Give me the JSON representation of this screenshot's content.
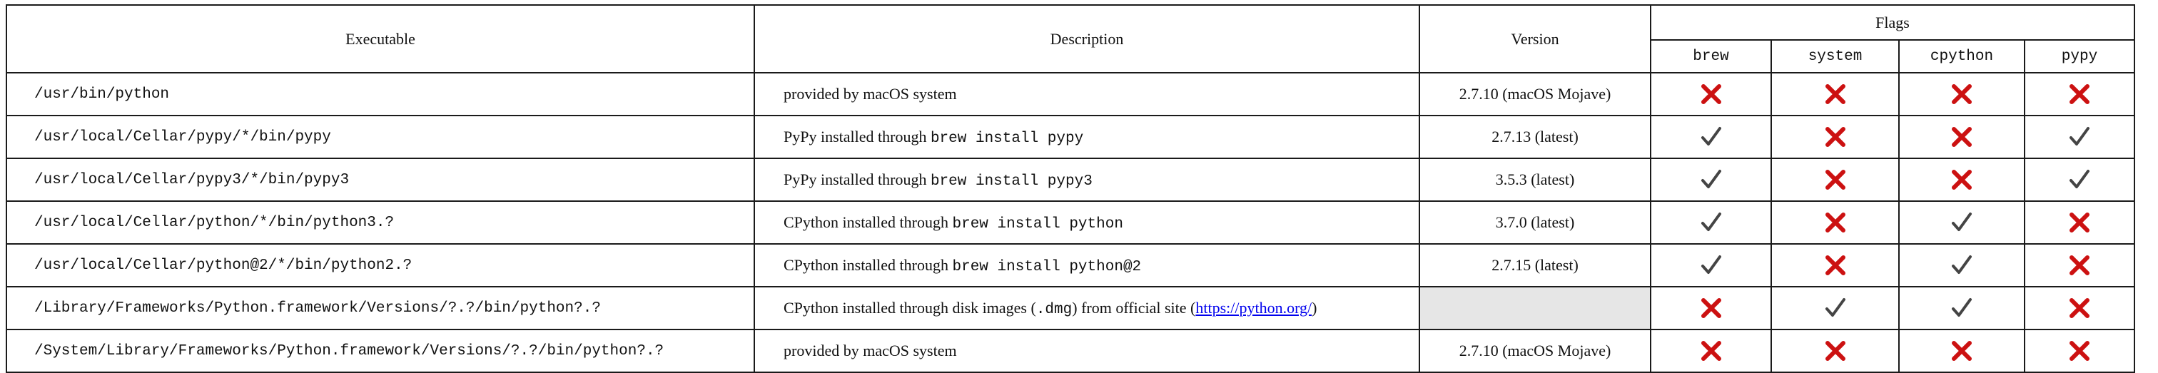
{
  "headers": {
    "executable": "Executable",
    "description": "Description",
    "version": "Version",
    "flags": "Flags",
    "flag_names": [
      "brew",
      "system",
      "cpython",
      "pypy"
    ]
  },
  "colors": {
    "cross": "#cc1111",
    "check": "#444444",
    "empty_cell": "#e6e6e6"
  },
  "icons": {
    "yes": "check-icon",
    "no": "cross-icon"
  },
  "rows": [
    {
      "executable": "/usr/bin/python",
      "desc_text": "provided by macOS system",
      "desc_code": "",
      "desc_suffix": "",
      "version": "2.7.10 (macOS Mojave)",
      "flags": [
        false,
        false,
        false,
        false
      ]
    },
    {
      "executable": "/usr/local/Cellar/pypy/*/bin/pypy",
      "desc_text": "PyPy installed through ",
      "desc_code": "brew install pypy",
      "desc_suffix": "",
      "version": "2.7.13 (latest)",
      "flags": [
        true,
        false,
        false,
        true
      ]
    },
    {
      "executable": "/usr/local/Cellar/pypy3/*/bin/pypy3",
      "desc_text": "PyPy installed through ",
      "desc_code": "brew install pypy3",
      "desc_suffix": "",
      "version": "3.5.3 (latest)",
      "flags": [
        true,
        false,
        false,
        true
      ]
    },
    {
      "executable": "/usr/local/Cellar/python/*/bin/python3.?",
      "desc_text": "CPython installed through ",
      "desc_code": "brew install python",
      "desc_suffix": "",
      "version": "3.7.0 (latest)",
      "flags": [
        true,
        false,
        true,
        false
      ]
    },
    {
      "executable": "/usr/local/Cellar/python@2/*/bin/python2.?",
      "desc_text": "CPython installed through ",
      "desc_code": "brew install python@2",
      "desc_suffix": "",
      "version": "2.7.15 (latest)",
      "flags": [
        true,
        false,
        true,
        false
      ]
    },
    {
      "executable": "/Library/Frameworks/Python.framework/Versions/?.?/bin/python?.?",
      "desc_text": "CPython installed through disk images (",
      "desc_code": ".dmg",
      "desc_suffix": ") from official site (",
      "desc_link": "https://python.org/",
      "desc_suffix2": ")",
      "version": "",
      "flags": [
        false,
        true,
        true,
        false
      ]
    },
    {
      "executable": "/System/Library/Frameworks/Python.framework/Versions/?.?/bin/python?.?",
      "desc_text": "provided by macOS system",
      "desc_code": "",
      "desc_suffix": "",
      "version": "2.7.10 (macOS Mojave)",
      "flags": [
        false,
        false,
        false,
        false
      ]
    }
  ]
}
